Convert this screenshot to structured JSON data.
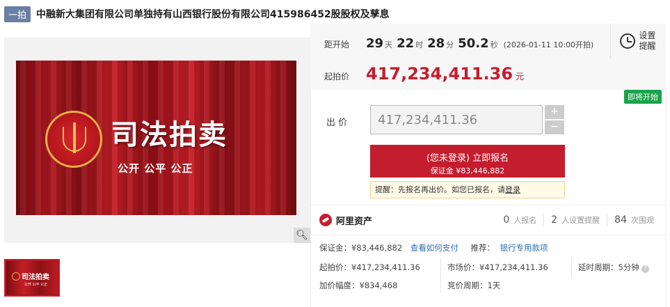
{
  "header": {
    "tag": "一拍",
    "title": "中融新大集团有限公司单独持有山西银行股份有限公司415986452股股权及孳息"
  },
  "banner": {
    "main_text": "司法拍卖",
    "sub_text": "公开 公平 公正",
    "thumb_text": "司法拍卖",
    "thumb_sub": "公开 公平 公正"
  },
  "countdown": {
    "label": "距开始",
    "days": "29",
    "days_unit": "天",
    "hours": "22",
    "hours_unit": "时",
    "minutes": "28",
    "minutes_unit": "分",
    "seconds": "50.2",
    "seconds_unit": "秒",
    "start_note": "(2026-01-11 10:00开拍)"
  },
  "start_price": {
    "label": "起拍价",
    "value": "417,234,411.36",
    "unit": "元"
  },
  "reminder": {
    "line1": "设置",
    "line2": "提醒"
  },
  "status_badge": "即将开始",
  "bid": {
    "label": "出  价",
    "value": "417,234,411.36",
    "plus": "+",
    "minus": "−"
  },
  "register": {
    "line1": "(您未登录) 立即报名",
    "line2": "保证金 ¥83,446,882"
  },
  "hint": {
    "text": "提醒：先报名再出价。如您已报名，请",
    "link": "登录"
  },
  "ali": {
    "name": "阿里资产",
    "signups": "0",
    "signups_label": "人报名",
    "reminders": "2",
    "reminders_label": "人设置提醒",
    "views": "84",
    "views_label": "次围观"
  },
  "details": {
    "deposit": "保证金：¥83,446,882",
    "how_to_pay": "查看如何支付",
    "recommend_label": "推荐：",
    "recommend_link": "银行专用款项",
    "start_price": "起拍价：¥417,234,411.36",
    "market_price": "市场价：¥417,234,411.36",
    "delay_period": "延时周期：5分钟",
    "increment": "加价幅度：¥834,468",
    "bid_period": "竞价周期：1天"
  },
  "colors": {
    "accent_red": "#c41d2e",
    "tag_blue": "#6a7fa3",
    "status_green": "#1aa34a",
    "link_blue": "#2e72b8"
  }
}
